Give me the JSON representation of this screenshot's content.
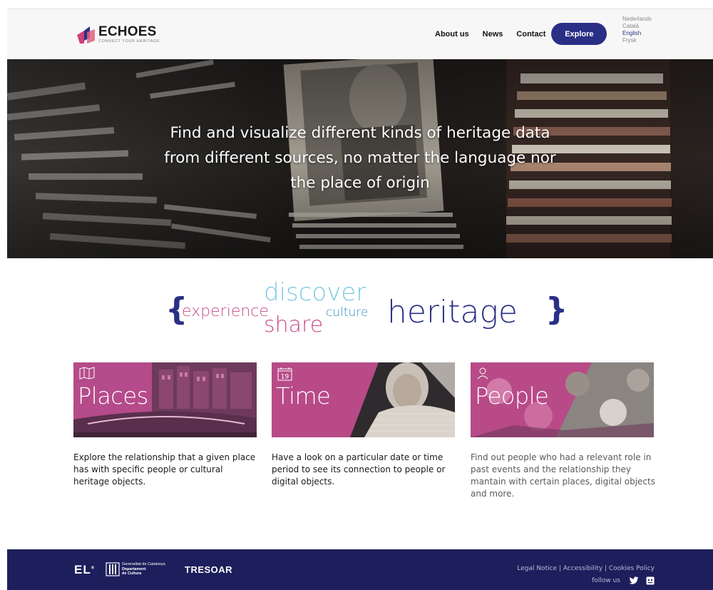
{
  "header": {
    "logo_title": "ECHOES",
    "logo_subtitle": "CONNECT YOUR HERITAGE",
    "nav": [
      "About us",
      "News",
      "Contact"
    ],
    "explore_label": "Explore",
    "languages": [
      "Nederlands",
      "Català",
      "English",
      "Frysk"
    ],
    "active_language": "English"
  },
  "hero": {
    "headline_lines": [
      "Find and visualize different kinds of heritage data",
      "from different sources, no matter the language nor",
      "the place of origin"
    ]
  },
  "tagline": {
    "open_brace": "{",
    "close_brace": "}",
    "experience": "experience",
    "discover": "discover",
    "share": "share",
    "culture": "culture",
    "heritage": "heritage"
  },
  "cards": [
    {
      "title": "Places",
      "icon": "map-icon",
      "description": "Explore the relationship that a given place has with specific people or cultural heritage objects."
    },
    {
      "title": "Time",
      "icon": "calendar-icon",
      "icon_text": "19",
      "description": "Have a look on a particular date or time period to see its connection to people or digital objects."
    },
    {
      "title": "People",
      "icon": "person-icon",
      "description": "Find out people who had a relevant role in past events and the relationship they mantain with certain places, digital objects and more."
    }
  ],
  "footer": {
    "partner_el": "EL",
    "partner_el_mark": "®",
    "partner_gencat_lines": [
      "Generalitat de Catalunya",
      "Departament",
      "de Cultura"
    ],
    "partner_tresoar": "TRESOAR",
    "links": [
      "Legal Notice",
      "Accessibility",
      "Cookies Policy"
    ],
    "separator": " | ",
    "follow_label": "follow us",
    "social_icons": [
      "twitter-icon",
      "github-icon"
    ]
  },
  "colors": {
    "primary": "#2a2f86",
    "magenta": "#c2407f",
    "pink_word": "#c84e88",
    "light_blue": "#7ec9e2",
    "footer": "#1d1f5c"
  }
}
